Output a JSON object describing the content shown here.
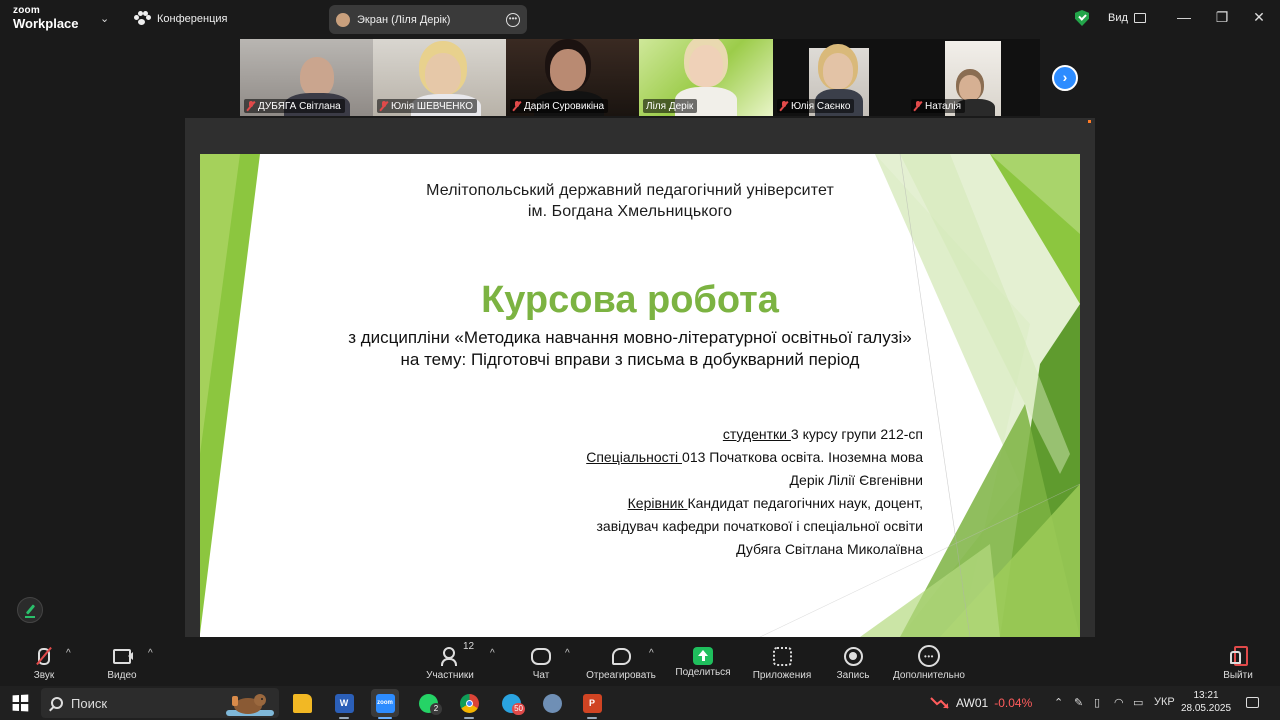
{
  "window": {
    "logo_line1": "zoom",
    "logo_line2": "Workplace",
    "conference_label": "Конференция",
    "screen_share_label": "Экран (Ліля Дерік)",
    "view_label": "Вид",
    "min_glyph": "—",
    "max_glyph": "❐",
    "close_glyph": "✕"
  },
  "participants": [
    {
      "name": "ДУБЯГА Світлана",
      "muted": true,
      "active": false
    },
    {
      "name": "Юлія ШЕВЧЕНКО",
      "muted": true,
      "active": false
    },
    {
      "name": "Дарія Суровикіна",
      "muted": true,
      "active": false
    },
    {
      "name": "Ліля Дерік",
      "muted": false,
      "active": true
    },
    {
      "name": "Юлія Саєнко",
      "muted": true,
      "active": false
    },
    {
      "name": "Наталія",
      "muted": true,
      "active": false
    }
  ],
  "slide": {
    "university_line1": "Мелітопольський державний педагогічний університет",
    "university_line2": "ім. Богдана Хмельницького",
    "title": "Курсова робота",
    "subtitle_line1": "з дисципліни «Методика навчання мовно-літературної освітньої галузі»",
    "subtitle_line2": "на тему: Підготовчі вправи з письма в добукварний період",
    "student_label": "студентки ",
    "student_value": "3 курсу групи 212-сп",
    "specialty_label": "Спеціальності ",
    "specialty_value": "013 Початкова освіта. Іноземна мова",
    "student_name": "Дерік Лілії Євгенівни",
    "supervisor_label": "Керівник ",
    "supervisor_value": "Кандидат педагогічних наук, доцент,",
    "supervisor_position": "завідувач кафедри початкової і спеціальної освіти",
    "supervisor_name": "Дубяга Світлана Миколаївна",
    "accent_color": "#7cb342"
  },
  "toolbar": {
    "audio_label": "Звук",
    "video_label": "Видео",
    "participants_label": "Участники",
    "participants_count": "12",
    "chat_label": "Чат",
    "react_label": "Отреагировать",
    "share_label": "Поделиться",
    "apps_label": "Приложения",
    "record_label": "Запись",
    "more_label": "Дополнительно",
    "leave_label": "Выйти",
    "share_color": "#1fbf5d",
    "leave_color": "#e04a4a"
  },
  "taskbar": {
    "search_placeholder": "Поиск",
    "apps": [
      {
        "name": "file-explorer",
        "label": "",
        "color": "#f2b824",
        "badge": ""
      },
      {
        "name": "word",
        "label": "W",
        "color": "#2b5fb8",
        "badge": ""
      },
      {
        "name": "zoom",
        "label": "zoom",
        "color": "#2d8cff",
        "badge": ""
      },
      {
        "name": "whatsapp",
        "label": "",
        "color": "#25d366",
        "badge": "2"
      },
      {
        "name": "chrome",
        "label": "",
        "color": "#db4437",
        "badge": ""
      },
      {
        "name": "telegram",
        "label": "",
        "color": "#2aa3e0",
        "badge": "50"
      },
      {
        "name": "edge-feather",
        "label": "",
        "color": "#6f8fb5",
        "badge": ""
      },
      {
        "name": "powerpoint",
        "label": "P",
        "color": "#d04423",
        "badge": ""
      }
    ],
    "stock_ticker": "AW01",
    "stock_change": "-0.04%",
    "language": "УКР",
    "time": "13:21",
    "date": "28.05.2025"
  }
}
